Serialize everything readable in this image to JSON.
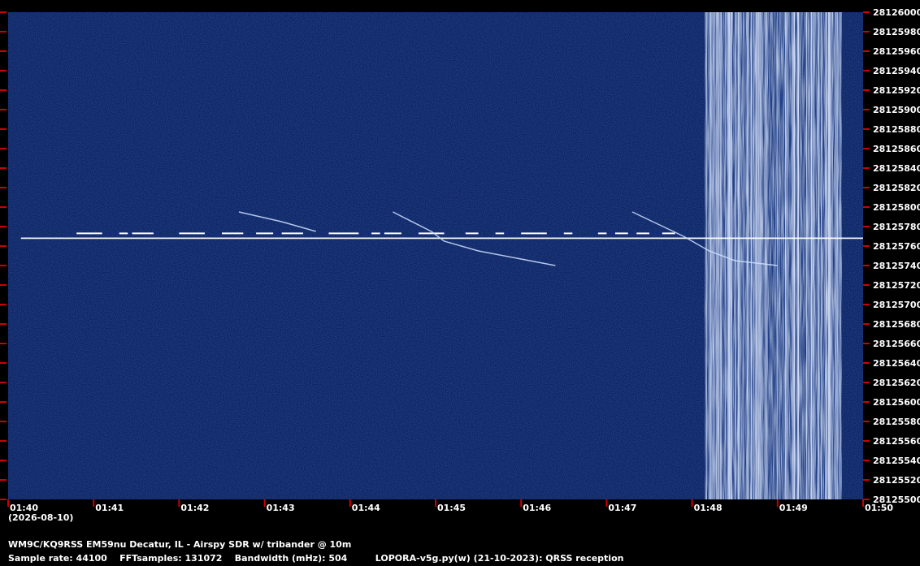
{
  "chart_data": {
    "type": "heatmap",
    "subtype": "waterfall-spectrogram",
    "title": "WM9C/KQ9RSS EM59nu Decatur, IL - Airspy SDR w/ tribander @ 10m",
    "date_label": "(2026-08-10)",
    "x_ticks": [
      "01:40",
      "01:41",
      "01:42",
      "01:43",
      "01:44",
      "01:45",
      "01:46",
      "01:47",
      "01:48",
      "01:49",
      "01:50"
    ],
    "x_range": [
      "01:40",
      "01:50"
    ],
    "y_ticks": [
      28125500,
      28125520,
      28125540,
      28125560,
      28125580,
      28125600,
      28125620,
      28125640,
      28125660,
      28125680,
      28125700,
      28125720,
      28125740,
      28125760,
      28125780,
      28125800,
      28125820,
      28125840,
      28125860,
      28125880,
      28125900,
      28125920,
      28125940,
      28125960,
      28125980,
      28126000
    ],
    "y_range": [
      28125500,
      28126000
    ],
    "colors": {
      "background": "#0a1f5c",
      "signal": "#ffffff",
      "tick": "#cc0000",
      "frame": "#000000"
    },
    "signals": {
      "carrier_fsk": {
        "base_freq_hz": 28125773,
        "shift_hz": 5,
        "start": "01:40.2",
        "end": "01:50",
        "keyed_segments_min": [
          [
            0.8,
            1.1
          ],
          [
            1.3,
            1.4
          ],
          [
            1.45,
            1.7
          ],
          [
            2.0,
            2.3
          ],
          [
            2.5,
            2.75
          ],
          [
            2.9,
            3.1
          ],
          [
            3.2,
            3.45
          ],
          [
            3.75,
            4.1
          ],
          [
            4.25,
            4.35
          ],
          [
            4.4,
            4.6
          ],
          [
            4.8,
            5.1
          ],
          [
            5.35,
            5.5
          ],
          [
            5.7,
            5.8
          ],
          [
            6.0,
            6.3
          ],
          [
            6.5,
            6.6
          ],
          [
            6.9,
            7.0
          ],
          [
            7.1,
            7.25
          ],
          [
            7.35,
            7.5
          ],
          [
            7.65,
            7.8
          ]
        ]
      },
      "meteor_traces": [
        {
          "freq_hz": [
            28125800,
            28125780,
            28125770,
            28125760,
            28125745
          ],
          "time_min": [
            4.5,
            4.95,
            5.1,
            5.5,
            6.4
          ]
        },
        {
          "freq_hz": [
            28125800,
            28125790,
            28125780
          ],
          "time_min": [
            2.7,
            3.2,
            3.6
          ]
        },
        {
          "freq_hz": [
            28125800,
            28125775,
            28125760,
            28125750,
            28125745
          ],
          "time_min": [
            7.3,
            7.9,
            8.2,
            8.5,
            9.0
          ]
        }
      ],
      "noise_band_min": [
        8.15,
        9.75
      ]
    }
  },
  "info": {
    "line1": "WM9C/KQ9RSS EM59nu Decatur, IL - Airspy SDR w/ tribander @ 10m",
    "line2": "Sample rate: 44100    FFTsamples: 131072    Bandwidth (mHz): 504         LOPORA-v5g.py(w) (21-10-2023): QRSS reception"
  }
}
